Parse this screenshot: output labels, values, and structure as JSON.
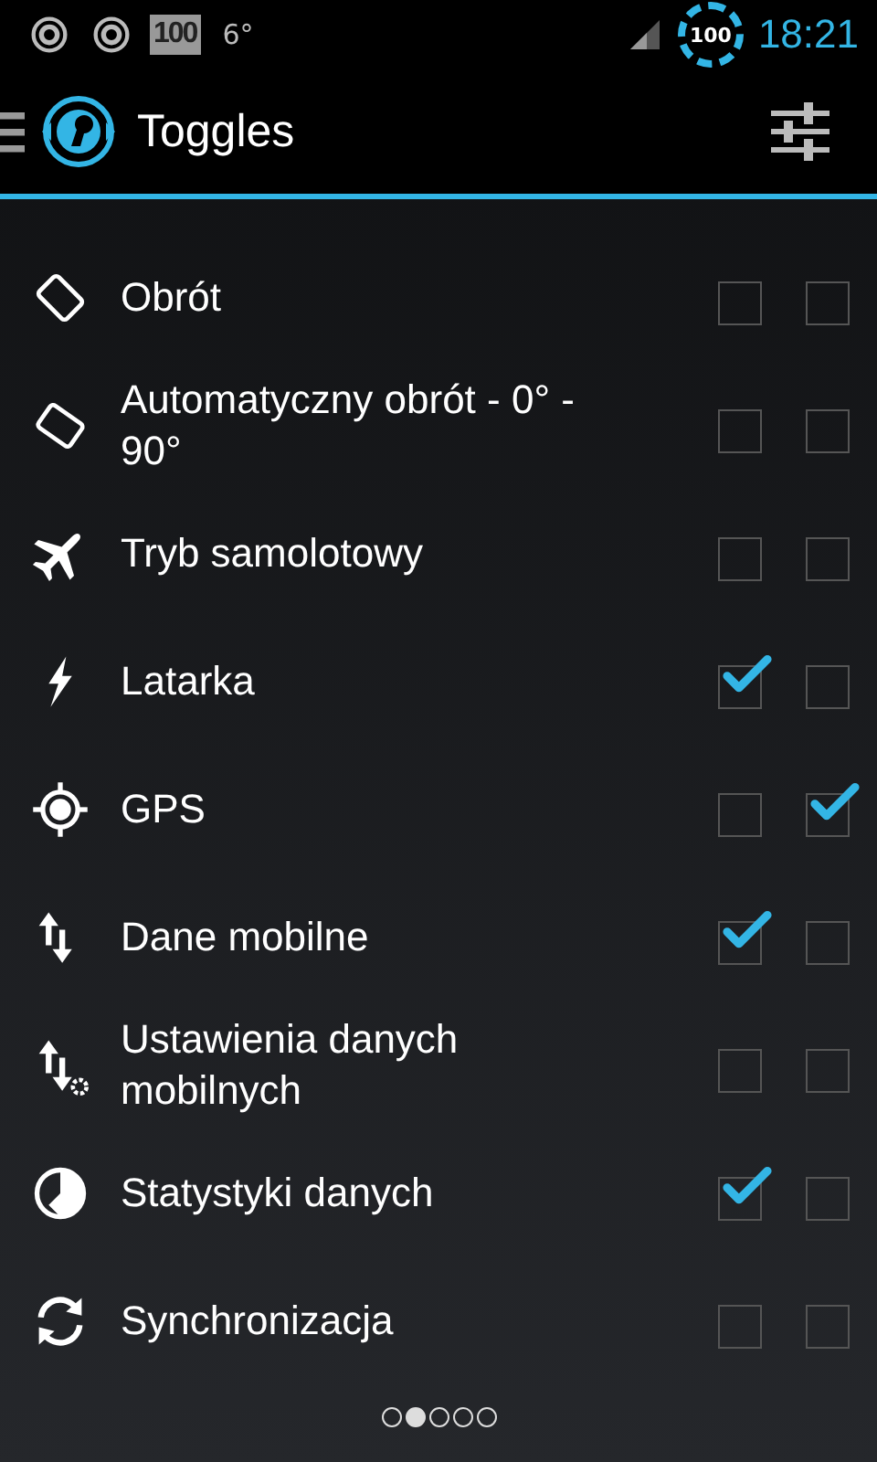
{
  "status_bar": {
    "badge": "100",
    "temperature": "6°",
    "battery": "100",
    "time": "18:21"
  },
  "action_bar": {
    "title": "Toggles"
  },
  "toggles": [
    {
      "label": "Obrót",
      "first_checked": false,
      "second_checked": false
    },
    {
      "label": "Automatyczny obrót - 0° - 90°",
      "first_checked": false,
      "second_checked": false
    },
    {
      "label": "Tryb samolotowy",
      "first_checked": false,
      "second_checked": false
    },
    {
      "label": "Latarka",
      "first_checked": true,
      "second_checked": false
    },
    {
      "label": "GPS",
      "first_checked": false,
      "second_checked": true
    },
    {
      "label": "Dane mobilne",
      "first_checked": true,
      "second_checked": false
    },
    {
      "label": "Ustawienia danych mobilnych",
      "first_checked": false,
      "second_checked": false
    },
    {
      "label": "Statystyki danych",
      "first_checked": true,
      "second_checked": false
    },
    {
      "label": "Synchronizacja",
      "first_checked": false,
      "second_checked": false
    }
  ],
  "pager": [
    {
      "selected": false
    },
    {
      "selected": true
    },
    {
      "selected": false
    },
    {
      "selected": false
    },
    {
      "selected": false
    }
  ]
}
